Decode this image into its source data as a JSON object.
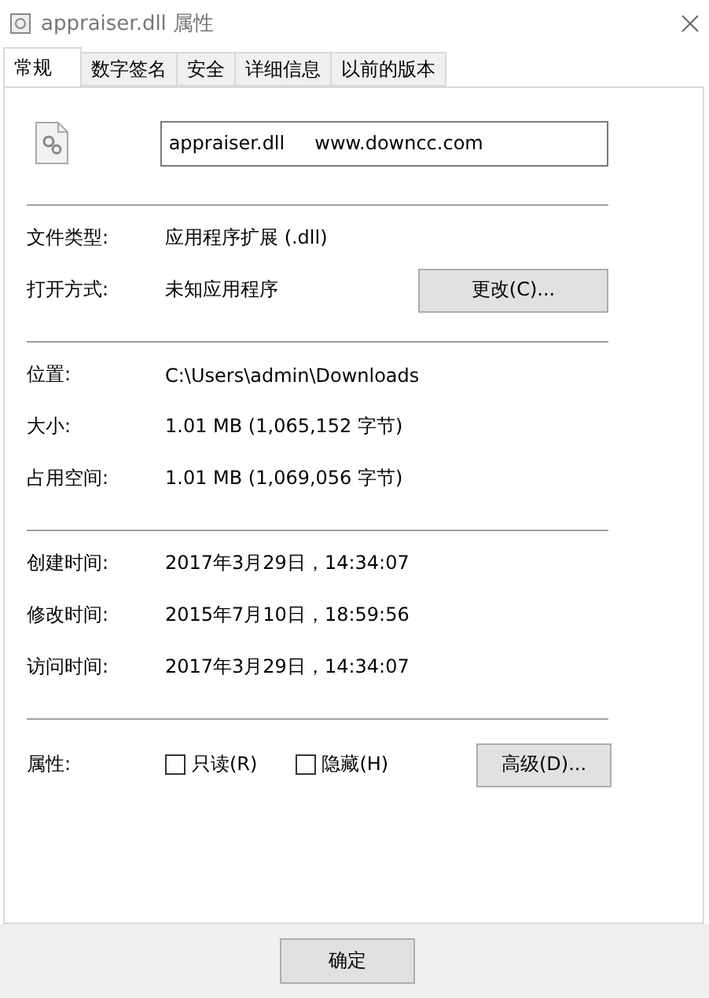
{
  "window": {
    "title": "appraiser.dll 属性"
  },
  "tabs": [
    {
      "label": "常规",
      "selected": true
    },
    {
      "label": "数字签名",
      "selected": false
    },
    {
      "label": "安全",
      "selected": false
    },
    {
      "label": "详细信息",
      "selected": false
    },
    {
      "label": "以前的版本",
      "selected": false
    }
  ],
  "file_name": {
    "value": "appraiser.dll     www.downcc.com"
  },
  "sections": [
    [
      {
        "label": "文件类型:",
        "value": "应用程序扩展 (.dll)"
      },
      {
        "label": "打开方式:",
        "value": "未知应用程序",
        "button": "更改(C)..."
      }
    ],
    [
      {
        "label": "位置:",
        "value": "C:\\Users\\admin\\Downloads"
      },
      {
        "label": "大小:",
        "value": "1.01 MB (1,065,152 字节)"
      },
      {
        "label": "占用空间:",
        "value": "1.01 MB (1,069,056 字节)"
      }
    ],
    [
      {
        "label": "创建时间:",
        "value": "2017年3月29日，14:34:07"
      },
      {
        "label": "修改时间:",
        "value": "2015年7月10日，18:59:56"
      },
      {
        "label": "访问时间:",
        "value": "2017年3月29日，14:34:07"
      }
    ]
  ],
  "attributes": {
    "label": "属性:",
    "checkboxes": [
      {
        "label": "只读(R)",
        "checked": false
      },
      {
        "label": "隐藏(H)",
        "checked": false
      }
    ],
    "button": "高级(D)..."
  },
  "footer_buttons": [
    "确定"
  ]
}
